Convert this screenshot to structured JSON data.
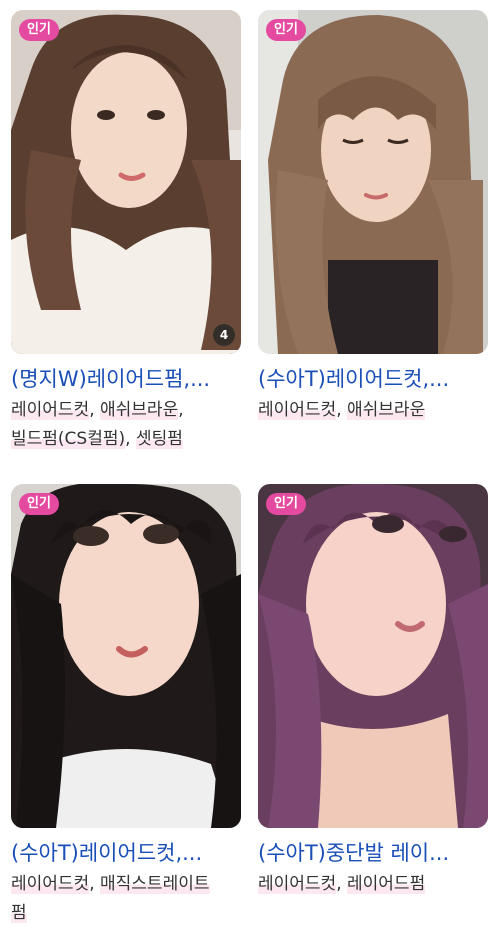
{
  "theme": {
    "badge_color": "#e44ba0",
    "title_color": "#1a4fb8"
  },
  "cards": [
    {
      "badge": "인기",
      "image_count": "4",
      "title": "(명지W)레이어드펌,...",
      "tags": [
        "레이어드컷",
        ", ",
        "애쉬브라운",
        ",",
        "빌드펌(CS컬펌)",
        ", ",
        "셋팅펌"
      ]
    },
    {
      "badge": "인기",
      "title": "(수아T)레이어드컷,...",
      "tags": [
        "레이어드컷",
        ", ",
        "애쉬브라운"
      ]
    },
    {
      "badge": "인기",
      "title": "(수아T)레이어드컷,...",
      "tags": [
        "레이어드컷",
        ", ",
        "매직스트레이트",
        "펌"
      ]
    },
    {
      "badge": "인기",
      "title": "(수아T)중단발 레이...",
      "tags": [
        "레이어드컷",
        ", ",
        "레이어드펌"
      ]
    }
  ]
}
